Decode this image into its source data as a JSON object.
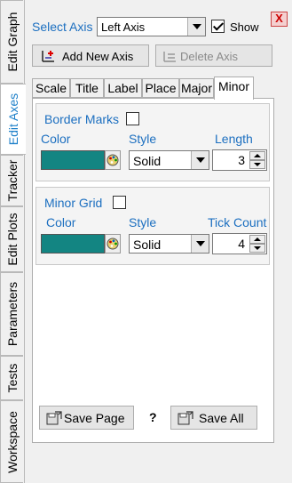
{
  "side_tabs": [
    "Edit Graph",
    "Edit Axes",
    "Tracker",
    "Edit Plots",
    "Parameters",
    "Tests",
    "Workspace"
  ],
  "active_side_tab": "Edit Axes",
  "close_label": "X",
  "select_axis": {
    "label": "Select Axis",
    "value": "Left Axis",
    "show_label": "Show",
    "show_checked": true
  },
  "buttons": {
    "add_axis": "Add New Axis",
    "delete_axis": "Delete Axis"
  },
  "tabs": [
    "Scale",
    "Title",
    "Label",
    "Place",
    "Major",
    "Minor"
  ],
  "active_tab": "Minor",
  "border_marks": {
    "title": "Border Marks",
    "checked": false,
    "color_label": "Color",
    "style_label": "Style",
    "style_value": "Solid",
    "length_label": "Length",
    "length_value": "3",
    "color": "#138582"
  },
  "minor_grid": {
    "title": "Minor Grid",
    "checked": false,
    "color_label": "Color",
    "style_label": "Style",
    "style_value": "Solid",
    "count_label": "Tick Count",
    "count_value": "4",
    "color": "#138582"
  },
  "footer": {
    "save_page": "Save Page",
    "help": "?",
    "save_all": "Save All"
  },
  "colors": {
    "accent_text": "#1c6fc0",
    "close_red": "#cc0000"
  }
}
